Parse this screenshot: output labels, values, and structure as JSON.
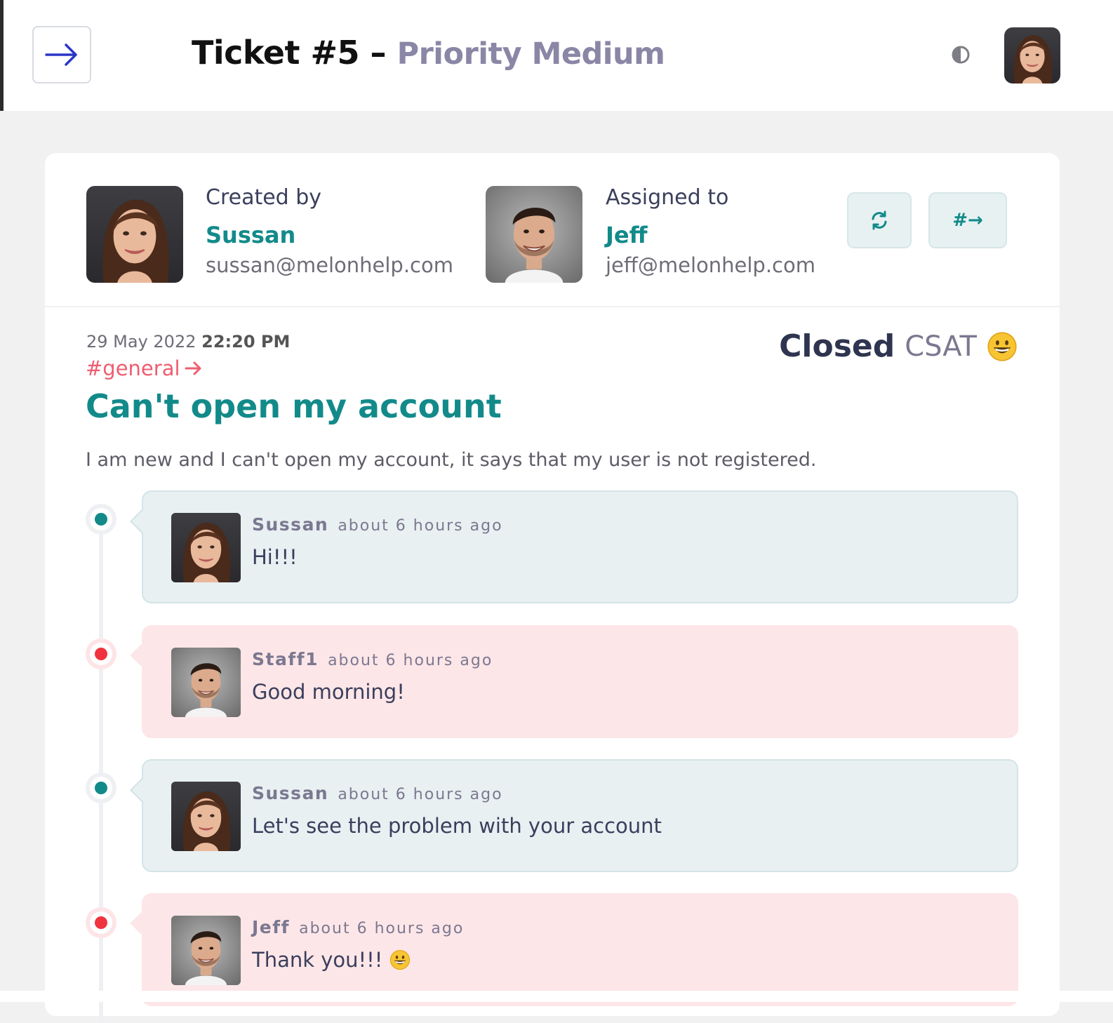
{
  "header": {
    "ticket_label": "Ticket #5",
    "separator": "–",
    "priority_label": "Priority Medium"
  },
  "ticket": {
    "created_by_label": "Created by",
    "creator_name": "Sussan",
    "creator_email": "sussan@melonhelp.com",
    "assigned_to_label": "Assigned to",
    "assignee_name": "Jeff",
    "assignee_email": "jeff@melonhelp.com",
    "reassign_button_label": "#→",
    "date": "29 May 2022",
    "time": "22:20 PM",
    "channel": "#general",
    "status": "Closed",
    "csat_label": "CSAT",
    "subject": "Can't open my account",
    "description": "I am new and I can't open my account, it says that my user is not registered."
  },
  "messages": [
    {
      "author": "Sussan",
      "time": "about 6 hours ago",
      "text": "Hi!!!",
      "side": "customer",
      "avatar": "woman"
    },
    {
      "author": "Staff1",
      "time": "about 6 hours ago",
      "text": "Good morning!",
      "side": "staff",
      "avatar": "man"
    },
    {
      "author": "Sussan",
      "time": "about 6 hours ago",
      "text": "Let's see the problem with your account",
      "side": "customer",
      "avatar": "woman"
    },
    {
      "author": "Jeff",
      "time": "about 6 hours ago",
      "text": "Thank you!!!",
      "side": "staff",
      "avatar": "man"
    }
  ],
  "icons": [
    "menu-arrow-icon",
    "contrast-icon",
    "refresh-icon",
    "smiley-emoji-icon"
  ],
  "colors": {
    "accent": "#138a8a",
    "danger": "#f0333f",
    "tag": "#ef5d6f",
    "priority": "#8a86a6"
  }
}
